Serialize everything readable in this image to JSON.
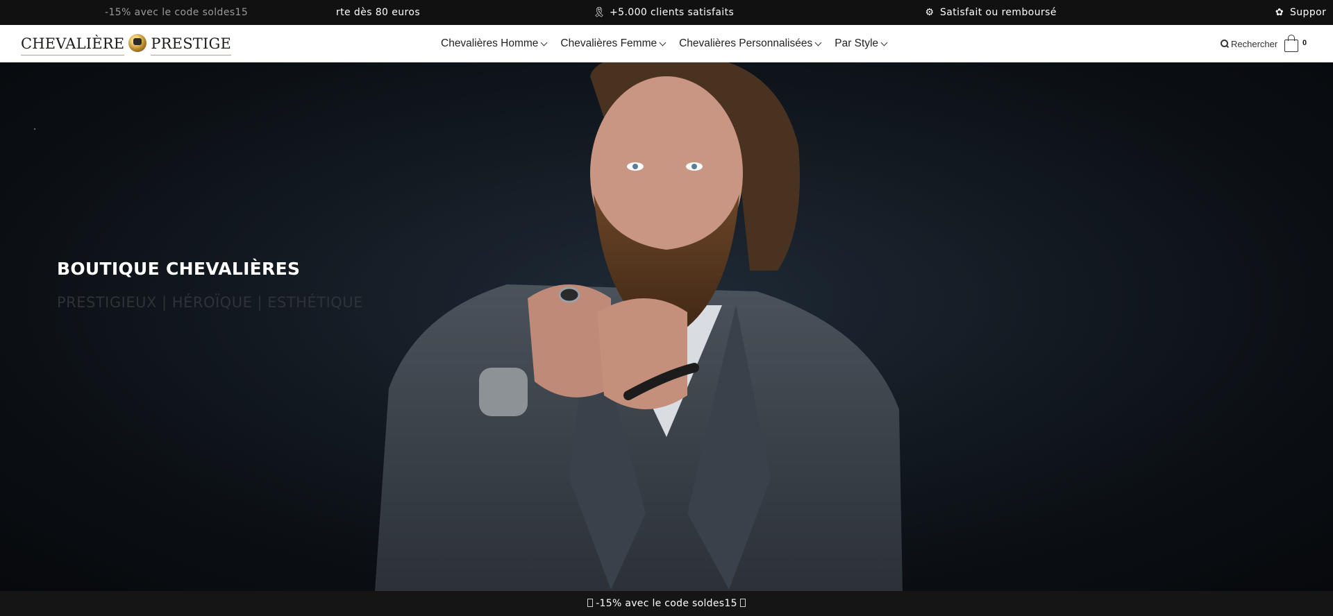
{
  "ticker": {
    "items": [
      {
        "text": "-15% avec le code soldes15",
        "icon": null
      },
      {
        "text": "rte dès 80 euros",
        "icon": null
      },
      {
        "text": "+5.000 clients satisfaits",
        "icon": "award-icon"
      },
      {
        "text": "Satisfait ou remboursé",
        "icon": "refund-icon"
      },
      {
        "text": "Suppor",
        "icon": "support-icon"
      }
    ]
  },
  "header": {
    "logo": {
      "left": "CHEVALIÈRE",
      "right": "PRESTIGE"
    },
    "nav": [
      {
        "label": "Chevalières Homme"
      },
      {
        "label": "Chevalières Femme"
      },
      {
        "label": "Chevalières Personnalisées"
      },
      {
        "label": "Par Style"
      }
    ],
    "search_label": "Rechercher",
    "cart_count": "0"
  },
  "hero": {
    "title": "BOUTIQUE CHEVALIÈRES",
    "subtitle": "PRESTIGIEUX | HÉROÏQUE | ESTHÉTIQUE"
  },
  "bottom_bar": {
    "text": "-15% avec le code soldes15"
  },
  "colors": {
    "topbar_bg": "#111111",
    "header_bg": "#ffffff",
    "hero_bg": "#0b0f14",
    "logo_accent": "#c9a24a"
  }
}
